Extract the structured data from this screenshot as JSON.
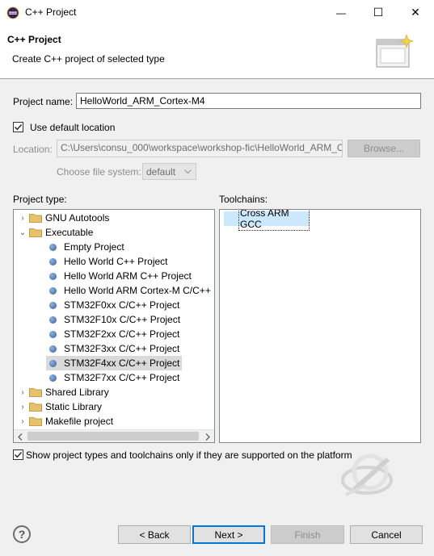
{
  "window": {
    "title": "C++ Project",
    "minimize": "—",
    "maximize": "☐",
    "close": "✕"
  },
  "banner": {
    "title": "C++ Project",
    "subtitle": "Create C++ project of selected type"
  },
  "project_name": {
    "label": "Project name:",
    "value": "HelloWorld_ARM_Cortex-M4"
  },
  "default_location": {
    "label": "Use default location",
    "checked": true
  },
  "location": {
    "label": "Location:",
    "value": "C:\\Users\\consu_000\\workspace\\workshop-fic\\HelloWorld_ARM_C",
    "browse": "Browse..."
  },
  "file_system": {
    "label": "Choose file system:",
    "value": "default"
  },
  "project_type": {
    "label": "Project type:",
    "items": [
      {
        "label": "GNU Autotools",
        "kind": "folder",
        "twisty": "›"
      },
      {
        "label": "Executable",
        "kind": "folder",
        "twisty": "⌄"
      },
      {
        "label": "Empty Project",
        "kind": "leaf"
      },
      {
        "label": "Hello World C++ Project",
        "kind": "leaf"
      },
      {
        "label": "Hello World ARM C++ Project",
        "kind": "leaf"
      },
      {
        "label": "Hello World ARM Cortex-M C/C++",
        "kind": "leaf"
      },
      {
        "label": "STM32F0xx C/C++ Project",
        "kind": "leaf"
      },
      {
        "label": "STM32F10x C/C++ Project",
        "kind": "leaf"
      },
      {
        "label": "STM32F2xx C/C++ Project",
        "kind": "leaf"
      },
      {
        "label": "STM32F3xx C/C++ Project",
        "kind": "leaf"
      },
      {
        "label": "STM32F4xx C/C++ Project",
        "kind": "leaf",
        "selected": true
      },
      {
        "label": "STM32F7xx C/C++ Project",
        "kind": "leaf"
      },
      {
        "label": "Shared Library",
        "kind": "folder",
        "twisty": "›"
      },
      {
        "label": "Static Library",
        "kind": "folder",
        "twisty": "›"
      },
      {
        "label": "Makefile project",
        "kind": "folder",
        "twisty": "›"
      }
    ]
  },
  "toolchains": {
    "label": "Toolchains:",
    "items": [
      {
        "label": "Cross ARM GCC",
        "selected": true
      }
    ]
  },
  "supported_only": {
    "label": "Show project types and toolchains only if they are supported on the platform",
    "checked": true
  },
  "buttons": {
    "help": "?",
    "back": "< Back",
    "next": "Next >",
    "finish": "Finish",
    "cancel": "Cancel"
  },
  "colors": {
    "folder": "#e8c26a",
    "selection": "#d9d9d9",
    "toolchain_selection": "#cce8ff",
    "default_button_border": "#0078d7"
  }
}
